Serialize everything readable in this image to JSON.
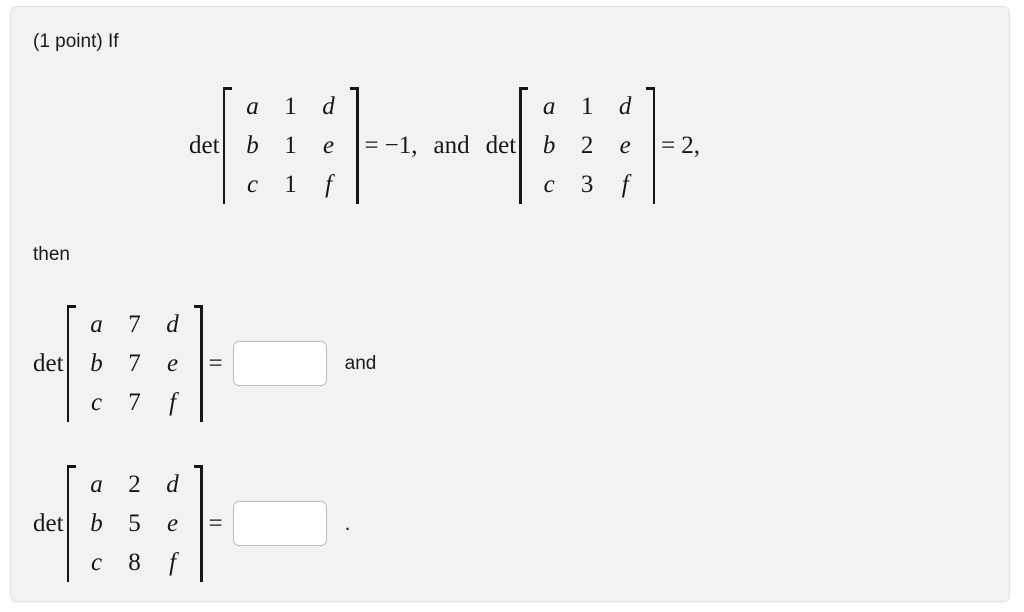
{
  "problem": {
    "points_label": "(1 point) If",
    "then_label": "then",
    "conjunction_math": "and",
    "conjunction_plain": "and",
    "trailing_period": "."
  },
  "symbols": {
    "det": "det",
    "equals": "=",
    "a": "a",
    "b": "b",
    "c": "c",
    "d": "d",
    "e": "e",
    "f": "f"
  },
  "given": [
    {
      "id": "given-determinant-1",
      "det_label": "det",
      "rows": [
        [
          "a",
          "1",
          "d"
        ],
        [
          "b",
          "1",
          "e"
        ],
        [
          "c",
          "1",
          "f"
        ]
      ],
      "equals": "=",
      "value": "−1,"
    },
    {
      "id": "given-determinant-2",
      "det_label": "det",
      "rows": [
        [
          "a",
          "1",
          "d"
        ],
        [
          "b",
          "2",
          "e"
        ],
        [
          "c",
          "3",
          "f"
        ]
      ],
      "equals": "=",
      "value": "2,"
    }
  ],
  "questions": [
    {
      "id": "question-determinant-1",
      "det_label": "det",
      "rows": [
        [
          "a",
          "7",
          "d"
        ],
        [
          "b",
          "7",
          "e"
        ],
        [
          "c",
          "7",
          "f"
        ]
      ],
      "equals": "=",
      "answer_value": "",
      "answer_placeholder": "",
      "trailing_text": "and"
    },
    {
      "id": "question-determinant-2",
      "det_label": "det",
      "rows": [
        [
          "a",
          "2",
          "d"
        ],
        [
          "b",
          "5",
          "e"
        ],
        [
          "c",
          "8",
          "f"
        ]
      ],
      "equals": "=",
      "answer_value": "",
      "answer_placeholder": "",
      "trailing_text": "."
    }
  ],
  "colors": {
    "panel_background": "#f2f2f2",
    "panel_border": "#e2e2e2",
    "page_background": "#ffffff",
    "text": "#1a1a1a",
    "math_text": "#16161a",
    "input_border": "#bdbdbd",
    "input_background": "#ffffff"
  }
}
